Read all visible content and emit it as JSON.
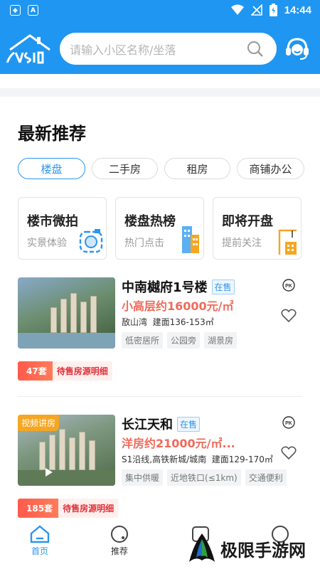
{
  "status_bar": {
    "time": "14:44"
  },
  "search": {
    "placeholder": "请输入小区名称/坐落"
  },
  "section_title": "最新推荐",
  "tabs": [
    {
      "label": "楼盘",
      "active": true
    },
    {
      "label": "二手房",
      "active": false
    },
    {
      "label": "租房",
      "active": false
    },
    {
      "label": "商铺办公",
      "active": false
    }
  ],
  "cards": [
    {
      "title": "楼市微拍",
      "subtitle": "实景体验",
      "icon": "camera-icon"
    },
    {
      "title": "楼盘热榜",
      "subtitle": "热门点击",
      "icon": "building-icon"
    },
    {
      "title": "即将开盘",
      "subtitle": "提前关注",
      "icon": "crane-icon"
    }
  ],
  "listings": [
    {
      "name": "中南樾府1号楼",
      "status": "在售",
      "price": "小高层约16000元/㎡",
      "location": "敔山湾",
      "area": "建面136-153㎡",
      "tags": [
        "低密居所",
        "公园旁",
        "湖景房"
      ],
      "stock_count": "47套",
      "stock_label": "待售房源明细",
      "badge": ""
    },
    {
      "name": "长江天和",
      "status": "在售",
      "price": "洋房约21000元/㎡...",
      "location": "S1沿线,高铁新城/城南",
      "area": "建面129-170㎡",
      "tags": [
        "集中供暖",
        "近地铁口(≤1km)",
        "交通便利"
      ],
      "stock_count": "185套",
      "stock_label": "待售房源明细",
      "badge": "视频讲房"
    }
  ],
  "bottom_nav": [
    {
      "label": "首页",
      "active": true
    },
    {
      "label": "推荐",
      "active": false
    },
    {
      "label": "",
      "active": false
    },
    {
      "label": "",
      "active": false
    }
  ],
  "watermark": {
    "text": "极限手游网"
  },
  "colors": {
    "primary": "#1f96f1",
    "price": "#f06a5a",
    "stock": "#ff5b4a"
  }
}
